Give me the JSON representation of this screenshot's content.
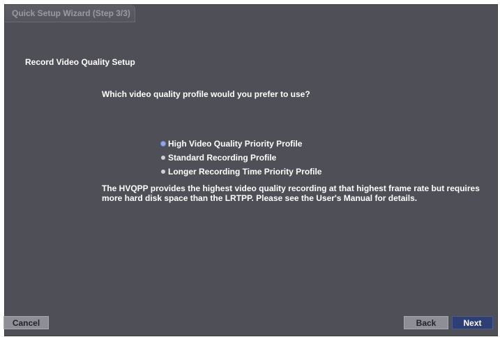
{
  "window": {
    "title": "Quick Setup Wizard (Step 3/3)"
  },
  "section_title": "Record Video Quality Setup",
  "question": "Which video quality profile would you prefer to use?",
  "options": [
    {
      "label": "High Video Quality Priority Profile",
      "selected": true
    },
    {
      "label": "Standard Recording Profile",
      "selected": false
    },
    {
      "label": "Longer Recording Time Priority Profile",
      "selected": false
    }
  ],
  "description": "The HVQPP provides the highest video quality recording at that highest frame rate but requires more hard disk space than the LRTPP. Please see the User's Manual for details.",
  "buttons": {
    "cancel": "Cancel",
    "back": "Back",
    "next": "Next"
  },
  "colors": {
    "background": "#4f4f57",
    "selected_radio": "#8fa8e6",
    "primary_button": "#2e3f75",
    "secondary_button": "#8e8e96"
  }
}
